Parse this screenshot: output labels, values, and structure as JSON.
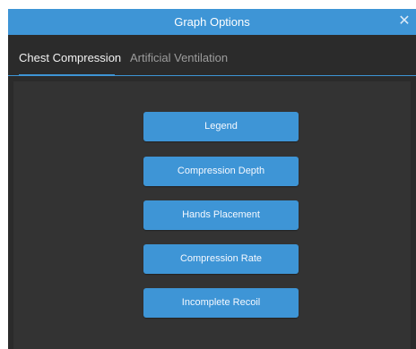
{
  "dialog": {
    "title": "Graph Options",
    "close_icon": "close-icon"
  },
  "tabs": [
    {
      "label": "Chest Compression",
      "active": true
    },
    {
      "label": "Artificial Ventilation",
      "active": false
    }
  ],
  "buttons": [
    {
      "label": "Legend"
    },
    {
      "label": "Compression Depth"
    },
    {
      "label": "Hands Placement"
    },
    {
      "label": "Compression Rate"
    },
    {
      "label": "Incomplete Recoil"
    }
  ],
  "colors": {
    "accent": "#3e95d6",
    "panel_bg": "#2b2b2b",
    "content_bg": "#333333"
  }
}
